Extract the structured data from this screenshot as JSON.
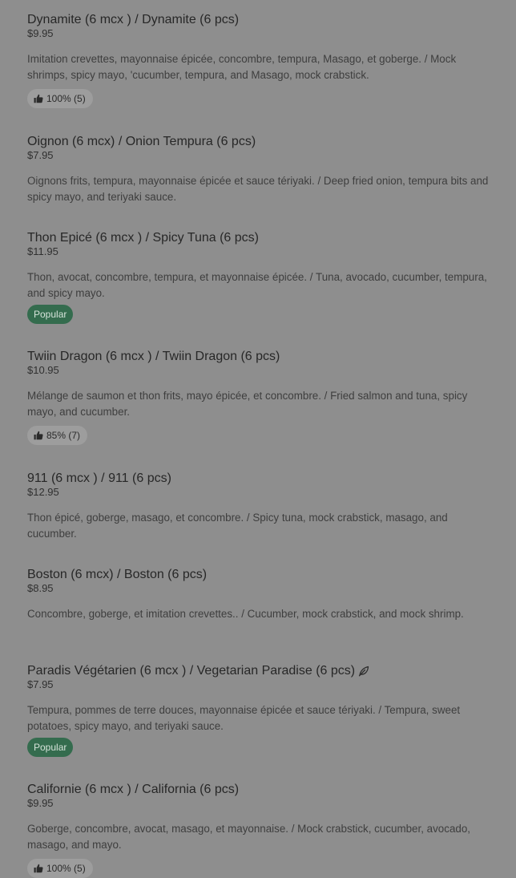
{
  "menu": {
    "items": [
      {
        "name": "Dynamite (6 mcx ) / Dynamite (6 pcs)",
        "price": "$9.95",
        "description": "Imitation crevettes, mayonnaise épicée, concombre, tempura, Masago, et goberge. / Mock shrimps, spicy mayo, 'cucumber, tempura, and Masago, mock crabstick.",
        "rating": "100% (5)"
      },
      {
        "name": "Oignon (6 mcx) / Onion Tempura (6 pcs)",
        "price": "$7.95",
        "description": "Oignons frits, tempura, mayonnaise épicée et sauce tériyaki. / Deep fried onion, tempura bits and spicy mayo, and teriyaki sauce."
      },
      {
        "name": "Thon Epicé (6 mcx ) / Spicy Tuna (6 pcs)",
        "price": "$11.95",
        "description": "Thon, avocat, concombre, tempura, et mayonnaise épicée. / Tuna, avocado, cucumber, tempura, and spicy mayo.",
        "badge": "Popular"
      },
      {
        "name": "Twiin Dragon (6 mcx ) / Twiin Dragon (6 pcs)",
        "price": "$10.95",
        "description": "Mélange de saumon et thon frits, mayo épicée, et concombre. / Fried salmon and tuna, spicy mayo, and cucumber.",
        "rating": "85% (7)"
      },
      {
        "name": "911 (6 mcx ) / 911 (6 pcs)",
        "price": "$12.95",
        "description": "Thon épicé, goberge, masago, et concombre. / Spicy tuna, mock crabstick, masago, and cucumber."
      },
      {
        "name": "Boston (6 mcx) / Boston (6 pcs)",
        "price": "$8.95",
        "description": "Concombre, goberge, et imitation crevettes.. / Cucumber, mock crabstick, and mock shrimp."
      },
      {
        "name": "Paradis Végétarien (6 mcx ) / Vegetarian Paradise (6 pcs)",
        "price": "$7.95",
        "description": "Tempura, pommes de terre douces, mayonnaise épicée et sauce tériyaki. / Tempura, sweet potatoes, spicy mayo, and teriyaki sauce.",
        "badge": "Popular",
        "dietary_icon": "leaf-icon"
      },
      {
        "name": "Californie (6 mcx ) / California (6 pcs)",
        "price": "$9.95",
        "description": "Goberge, concombre, avocat, masago, et mayonnaise. / Mock crabstick, cucumber, avocado, masago, and mayo.",
        "rating": "100% (5)"
      }
    ]
  },
  "icons": {
    "rating": "thumbs-up-icon",
    "vegetarian": "leaf-icon"
  },
  "colors": {
    "page_background": "#8e8e8e",
    "popular_badge": "#346c4e",
    "rating_badge": "#9d9d9d"
  }
}
